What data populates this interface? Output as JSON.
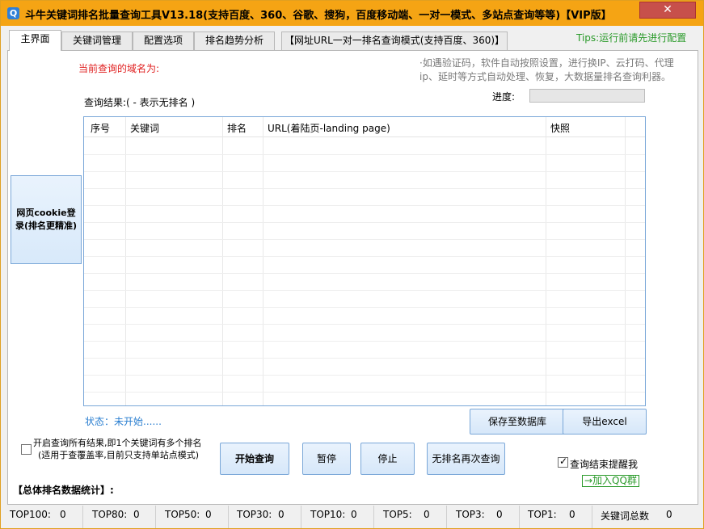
{
  "window": {
    "title": "斗牛关键词排名批量查询工具V13.18(支持百度、360、谷歌、搜狗，百度移动端、一对一模式、多站点查询等等)【VIP版】",
    "app_icon": "search-icon",
    "close_icon": "close-icon"
  },
  "tabs": [
    {
      "label": "主界面",
      "active": true
    },
    {
      "label": "关键词管理",
      "active": false
    },
    {
      "label": "配置选项",
      "active": false
    },
    {
      "label": "排名趋势分析",
      "active": false
    },
    {
      "label": "【网址URL一对一排名查询模式(支持百度、360)】",
      "active": false
    }
  ],
  "tips": "Tips:运行前请先进行配置",
  "main": {
    "domain_label": "当前查询的域名为:",
    "description": "·如遇验证码，软件自动按照设置，进行换IP、云打码、代理ip、延时等方式自动处理、恢复，大数据量排名查询利器。",
    "progress_label": "进度:",
    "progress_value": 0,
    "result_label": "查询结果:( - 表示无排名 )",
    "cookie_button": "网页cookie登录(排名更精准)",
    "columns": [
      "序号",
      "关键词",
      "排名",
      "URL(着陆页-landing page)",
      "快照"
    ],
    "rows": [],
    "status": "状态：未开始......",
    "buttons": {
      "save_db": "保存至数据库",
      "export_excel": "导出excel",
      "start": "开始查询",
      "pause": "暂停",
      "stop": "停止",
      "requery": "无排名再次查询"
    },
    "multi_result_checkbox": {
      "checked": false,
      "line1": "开启查询所有结果,即1个关键词有多个排名",
      "line2": "(适用于查覆盖率,目前只支持单站点模式)"
    },
    "remind_checkbox": {
      "checked": true,
      "label": "查询结束提醒我"
    },
    "qq_link": "→加入QQ群",
    "total_label": "【总体排名数据统计】:"
  },
  "statusbar": [
    {
      "label": "TOP100:",
      "value": "0"
    },
    {
      "label": "TOP80:",
      "value": "0"
    },
    {
      "label": "TOP50:",
      "value": "0"
    },
    {
      "label": "TOP30:",
      "value": "0"
    },
    {
      "label": "TOP10:",
      "value": "0"
    },
    {
      "label": "TOP5:",
      "value": "0"
    },
    {
      "label": "TOP3:",
      "value": "0"
    },
    {
      "label": "TOP1:",
      "value": "0"
    },
    {
      "label": "关键词总数",
      "value": "0"
    }
  ],
  "colors": {
    "titlebar": "#f5a414",
    "close_button": "#c7504b",
    "tips": "#2a9a2a",
    "domain_label": "#e02020",
    "status": "#2b7fd0",
    "description": "#7b7b7b"
  }
}
